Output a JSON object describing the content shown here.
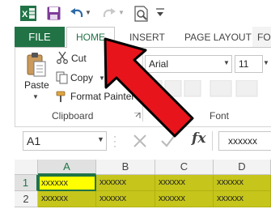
{
  "qat": {
    "app_icon": "excel-icon",
    "save_icon": "save-icon",
    "undo_icon": "undo-icon",
    "redo_icon": "redo-icon",
    "preview_icon": "print-preview-icon",
    "customize_icon": "customize-qat-icon"
  },
  "tabs": {
    "file": "FILE",
    "home": "HOME",
    "insert": "INSERT",
    "page_layout": "PAGE LAYOUT",
    "formulas": "FO"
  },
  "clipboard": {
    "paste": "Paste",
    "cut": "Cut",
    "copy": "Copy",
    "format_painter": "Format Painter",
    "group_label": "Clipboard"
  },
  "font": {
    "name": "Arial",
    "size": "11",
    "group_label": "Font"
  },
  "formula_bar": {
    "name_box": "A1",
    "formula": "xxxxxx",
    "fx": "fx"
  },
  "grid": {
    "columns": [
      "A",
      "B",
      "C",
      "D"
    ],
    "rows": [
      {
        "num": "1",
        "cells": [
          "xxxxxx",
          "xxxxxx",
          "xxxxxx",
          "xxxxxx"
        ]
      },
      {
        "num": "2",
        "cells": [
          "xxxxxx",
          "xxxxxx",
          "xxxxxx",
          "xxxxxx"
        ]
      }
    ]
  },
  "colors": {
    "excel_green": "#217346",
    "cell_fill": "#c5c51b",
    "active_cell_fill": "#ffff00",
    "arrow_red": "#e8141b"
  }
}
